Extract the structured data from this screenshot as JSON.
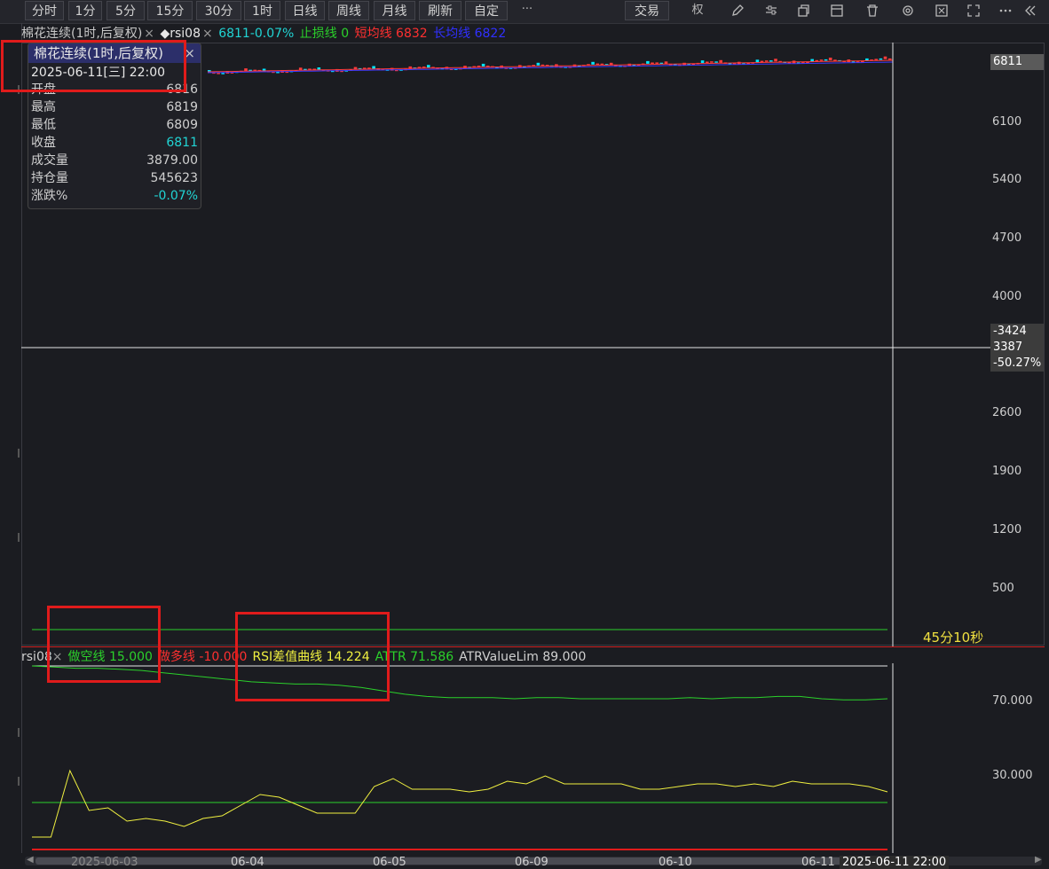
{
  "toolbar": {
    "periods": [
      "分时",
      "1分",
      "5分",
      "15分",
      "30分",
      "1时",
      "日线",
      "周线",
      "月线",
      "刷新",
      "自定"
    ],
    "more": "···",
    "trade": "交易",
    "quan": "权",
    "icons": [
      "pencil-icon",
      "sliders-icon",
      "copy-icon",
      "window-icon",
      "trash-icon",
      "settings-icon",
      "fullscreen-icon",
      "expand-icon",
      "more-icon",
      "collapse-icon"
    ]
  },
  "infobar": {
    "title": "棉花连续(1时,后复权)",
    "close": "×",
    "indicator": "◆rsi08",
    "close2": "×",
    "price_change": "6811-0.07%",
    "stoploss": "止损线 0",
    "short_ma": "短均线 6832",
    "long_ma": "长均线 6822"
  },
  "tooltip": {
    "title": "棉花连续(1时,后复权)",
    "close": "×",
    "date": "2025-06-11[三] 22:00",
    "rows": [
      {
        "label": "开盘",
        "value": "6816"
      },
      {
        "label": "最高",
        "value": "6819"
      },
      {
        "label": "最低",
        "value": "6809"
      },
      {
        "label": "收盘",
        "value": "6811"
      },
      {
        "label": "成交量",
        "value": "3879.00"
      },
      {
        "label": "持仓量",
        "value": "545623"
      },
      {
        "label": "涨跌%",
        "value": "-0.07%"
      }
    ]
  },
  "main_yaxis": {
    "price_tag": "6811",
    "labels": [
      "6100",
      "5400",
      "4700",
      "4000",
      "2600",
      "1900",
      "1200",
      "500"
    ],
    "cross_tags": [
      "-3424",
      "3387",
      "-50.27%"
    ]
  },
  "countdown": "45分10秒",
  "sub_info": {
    "name": "rsi08",
    "close": "×",
    "short_line": "做空线 15.000",
    "long_line": "做多线 -10.000",
    "rsi_diff": "RSI差值曲线 14.224",
    "attr": "ATTR 71.586",
    "atr_lim": "ATRValueLim 89.000"
  },
  "sub_yaxis": [
    "70.000",
    "30.000"
  ],
  "xaxis": {
    "labels": [
      "2025-06-03",
      "06-04",
      "06-05",
      "06-09",
      "06-10",
      "06-11"
    ],
    "cursor_label": "2025-06-11 22:00"
  },
  "colors": {
    "up": "#ff3b3b",
    "down": "#00e5ff",
    "green": "#2bd12b",
    "yellow": "#f0f040",
    "red": "#e01b1b",
    "blue": "#3a3aff",
    "cyan": "#21d4d4"
  },
  "chart_data": [
    {
      "type": "line",
      "title": "棉花连续(1时,后复权)",
      "y_ticks": [
        6100,
        5400,
        4700,
        4000,
        2600,
        1900,
        1200,
        500
      ],
      "last_price": 6811,
      "series": [
        {
          "name": "短均线",
          "last": 6832
        },
        {
          "name": "长均线",
          "last": 6822
        }
      ]
    },
    {
      "type": "line",
      "title": "rsi08",
      "y_ticks": [
        70,
        30
      ],
      "series": [
        {
          "name": "做空线",
          "value": 15.0
        },
        {
          "name": "做多线",
          "value": -10.0
        },
        {
          "name": "RSI差值曲线",
          "last": 14.224,
          "values": [
            2,
            2,
            27,
            12,
            13,
            8,
            9,
            8,
            6,
            9,
            10,
            14,
            18,
            17,
            14,
            11,
            11,
            11,
            21,
            24,
            20,
            20,
            20,
            19,
            20,
            23,
            22,
            25,
            22,
            22,
            22,
            22,
            20,
            20,
            21,
            22,
            22,
            21,
            22,
            21,
            23,
            22,
            22,
            22,
            21,
            19
          ]
        },
        {
          "name": "ATTR",
          "last": 71.586,
          "values": [
            100,
            99,
            98,
            98,
            97,
            96,
            94,
            92,
            90,
            88,
            86,
            85,
            84,
            84,
            83,
            81,
            78,
            75,
            73,
            72,
            72,
            72,
            71,
            72,
            72,
            71,
            71,
            71,
            71,
            71,
            72,
            71,
            72,
            72,
            73,
            73,
            71,
            70,
            70,
            71
          ]
        },
        {
          "name": "ATRValueLim",
          "value": 89.0
        }
      ]
    }
  ]
}
